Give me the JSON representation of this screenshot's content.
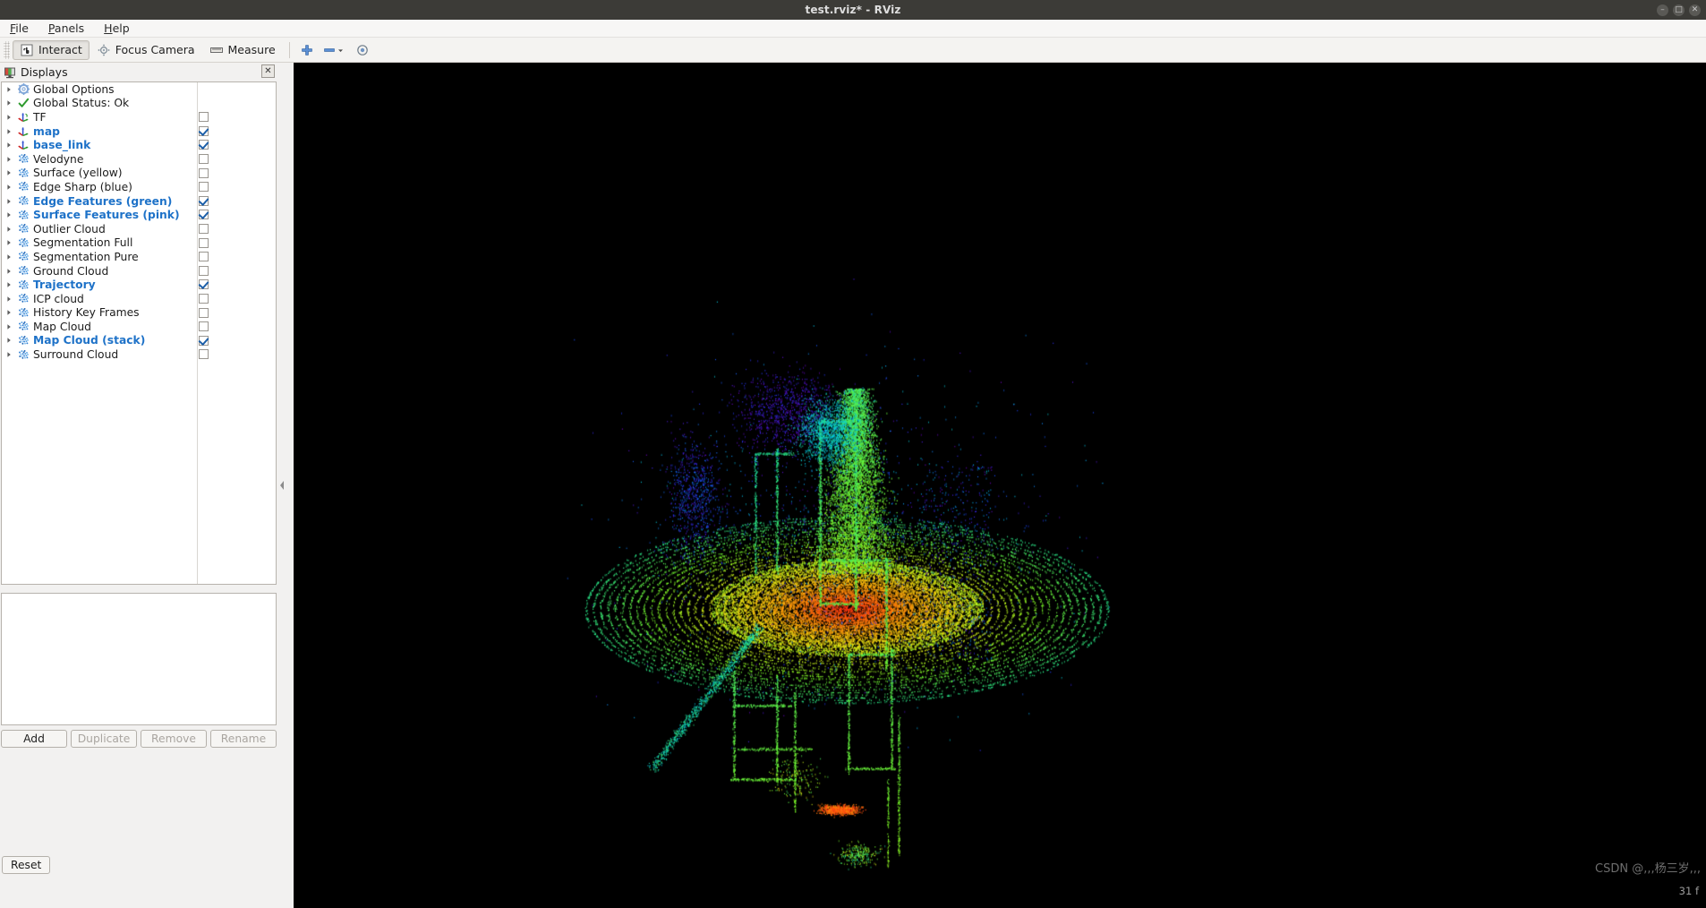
{
  "window": {
    "title": "test.rviz* - RViz",
    "buttons": [
      {
        "name": "minimize",
        "glyph": "–"
      },
      {
        "name": "maximize",
        "glyph": "□"
      },
      {
        "name": "close",
        "glyph": "✕"
      }
    ]
  },
  "menubar": {
    "items": [
      {
        "label": "File",
        "mnemonic": "F"
      },
      {
        "label": "Panels",
        "mnemonic": "P"
      },
      {
        "label": "Help",
        "mnemonic": "H"
      }
    ]
  },
  "toolbar": {
    "tools": [
      {
        "label": "Interact",
        "icon": "hand-cursor-icon",
        "active": true
      },
      {
        "label": "Focus Camera",
        "icon": "focus-camera-icon",
        "active": false
      },
      {
        "label": "Measure",
        "icon": "ruler-icon",
        "active": false
      }
    ],
    "extra": [
      {
        "name": "zoom-in-icon",
        "glyph": "+"
      },
      {
        "name": "zoom-out-icon",
        "glyph": "−"
      },
      {
        "name": "view-eye-icon",
        "glyph": "◉"
      }
    ]
  },
  "displays": {
    "panel_title": "Displays",
    "panel_icon": "displays-monitor-icon",
    "close_glyph": "✕",
    "tree": [
      {
        "label": "Global Options",
        "icon": "gear-icon",
        "enabled": false,
        "checkbox": false,
        "bold": false
      },
      {
        "label": "Global Status: Ok",
        "icon": "check-icon",
        "enabled": false,
        "checkbox": false,
        "bold": false
      },
      {
        "label": "TF",
        "icon": "tf-axes-icon",
        "enabled": false,
        "checkbox": true,
        "bold": false
      },
      {
        "label": "map",
        "icon": "axes-icon",
        "enabled": true,
        "checkbox": true,
        "bold": true
      },
      {
        "label": "base_link",
        "icon": "axes-icon",
        "enabled": true,
        "checkbox": true,
        "bold": true
      },
      {
        "label": "Velodyne",
        "icon": "pointcloud-icon",
        "enabled": false,
        "checkbox": true,
        "bold": false
      },
      {
        "label": "Surface (yellow)",
        "icon": "pointcloud-icon",
        "enabled": false,
        "checkbox": true,
        "bold": false
      },
      {
        "label": "Edge Sharp (blue)",
        "icon": "pointcloud-icon",
        "enabled": false,
        "checkbox": true,
        "bold": false
      },
      {
        "label": "Edge Features (green)",
        "icon": "pointcloud-icon",
        "enabled": true,
        "checkbox": true,
        "bold": true
      },
      {
        "label": "Surface Features (pink)",
        "icon": "pointcloud-icon",
        "enabled": true,
        "checkbox": true,
        "bold": true
      },
      {
        "label": "Outlier Cloud",
        "icon": "pointcloud-icon",
        "enabled": false,
        "checkbox": true,
        "bold": false
      },
      {
        "label": "Segmentation Full",
        "icon": "pointcloud-icon",
        "enabled": false,
        "checkbox": true,
        "bold": false
      },
      {
        "label": "Segmentation Pure",
        "icon": "pointcloud-icon",
        "enabled": false,
        "checkbox": true,
        "bold": false
      },
      {
        "label": "Ground Cloud",
        "icon": "pointcloud-icon",
        "enabled": false,
        "checkbox": true,
        "bold": false
      },
      {
        "label": "Trajectory",
        "icon": "pointcloud-icon",
        "enabled": true,
        "checkbox": true,
        "bold": true
      },
      {
        "label": "ICP cloud",
        "icon": "pointcloud-icon",
        "enabled": false,
        "checkbox": true,
        "bold": false
      },
      {
        "label": "History Key Frames",
        "icon": "pointcloud-icon",
        "enabled": false,
        "checkbox": true,
        "bold": false
      },
      {
        "label": "Map Cloud",
        "icon": "pointcloud-icon",
        "enabled": false,
        "checkbox": true,
        "bold": false
      },
      {
        "label": "Map Cloud (stack)",
        "icon": "pointcloud-icon",
        "enabled": true,
        "checkbox": true,
        "bold": true
      },
      {
        "label": "Surround Cloud",
        "icon": "pointcloud-icon",
        "enabled": false,
        "checkbox": true,
        "bold": false
      }
    ],
    "buttons": [
      {
        "label": "Add",
        "enabled": true
      },
      {
        "label": "Duplicate",
        "enabled": false
      },
      {
        "label": "Remove",
        "enabled": false
      },
      {
        "label": "Rename",
        "enabled": false
      }
    ]
  },
  "reset_button": {
    "label": "Reset"
  },
  "viewport": {
    "background": "#000000",
    "watermark": "CSDN @,,,杨三岁,,,",
    "fps_text": "31 f"
  }
}
